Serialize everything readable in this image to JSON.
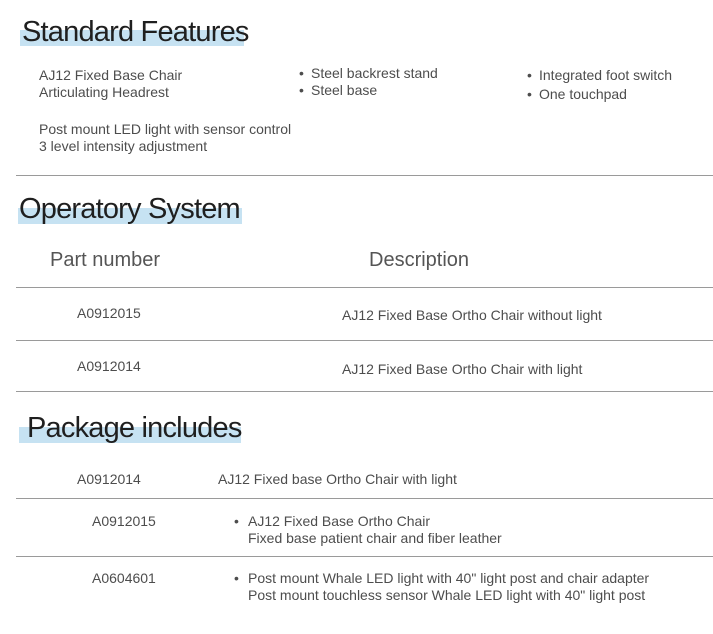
{
  "standard_features": {
    "heading": "Standard Features",
    "col1_group1": [
      "AJ12 Fixed Base Chair",
      "Articulating Headrest"
    ],
    "col1_group2": [
      "Post mount LED light with sensor control",
      "3 level intensity adjustment"
    ],
    "col2": [
      "Steel backrest stand",
      "Steel base"
    ],
    "col3": [
      "Integrated foot switch",
      "One touchpad"
    ]
  },
  "operatory_system": {
    "heading": "Operatory System",
    "col_part": "Part number",
    "col_desc": "Description",
    "rows": [
      {
        "part": "A0912015",
        "desc": "AJ12 Fixed Base Ortho Chair without light"
      },
      {
        "part": "A0912014",
        "desc": "AJ12 Fixed Base Ortho Chair with light"
      }
    ]
  },
  "package_includes": {
    "heading": "Package includes",
    "main": {
      "part": "A0912014",
      "desc": "AJ12 Fixed base Ortho Chair with light"
    },
    "items": [
      {
        "part": "A0912015",
        "lines": [
          "AJ12 Fixed Base Ortho Chair",
          "Fixed base patient chair and fiber leather"
        ]
      },
      {
        "part": "A0604601",
        "lines": [
          "Post mount Whale LED light with 40\" light post and chair adapter",
          "Post mount touchless sensor Whale LED light with 40\" light post"
        ]
      }
    ]
  },
  "colors": {
    "highlight": "#c6e2f2",
    "heading": "#1f1f1f",
    "text": "#4d4d4d",
    "rule": "#9a9a9a"
  }
}
